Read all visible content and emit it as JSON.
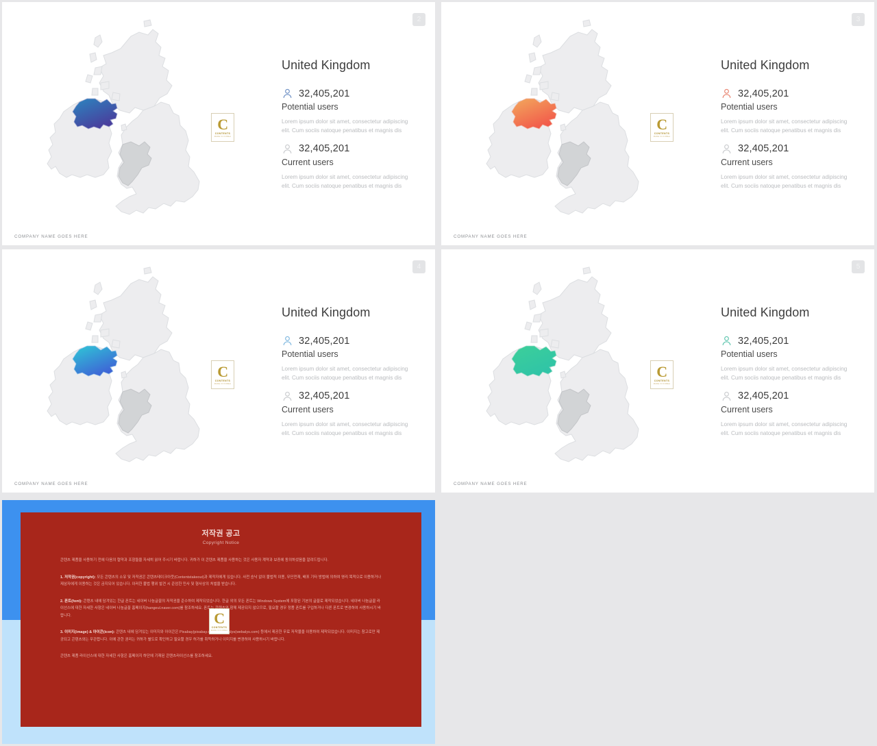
{
  "app": {
    "background": "#e7e7e9",
    "canvas_size": "1280x1089"
  },
  "brand": {
    "letter": "C",
    "name": "CONTENTS",
    "subtitle": "MADE  IN  KOREA"
  },
  "slides": [
    {
      "page": "2",
      "country": "United Kingdom",
      "accent": "#6d8fc4",
      "region_gradient_from": "#2b86c0",
      "region_gradient_to": "#4a3d9c",
      "highlight_region": "Northern Ireland",
      "secondary_region": "Wales",
      "potential": {
        "value": "32,405,201",
        "label": "Potential users",
        "desc": "Lorem ipsum dolor sit amet, consectetur adipiscing elit. Cum sociis natoque penatibus et magnis dis"
      },
      "current": {
        "value": "32,405,201",
        "label": "Current users",
        "desc": "Lorem ipsum dolor sit amet, consectetur adipiscing elit. Cum sociis natoque penatibus et magnis dis"
      },
      "footer": "COMPANY NAME GOES HERE"
    },
    {
      "page": "3",
      "country": "United Kingdom",
      "accent": "#e8836f",
      "region_gradient_from": "#f2a65c",
      "region_gradient_to": "#f2564a",
      "highlight_region": "Northern Ireland",
      "secondary_region": "Wales",
      "potential": {
        "value": "32,405,201",
        "label": "Potential users",
        "desc": "Lorem ipsum dolor sit amet, consectetur adipiscing elit. Cum sociis natoque penatibus et magnis dis"
      },
      "current": {
        "value": "32,405,201",
        "label": "Current users",
        "desc": "Lorem ipsum dolor sit amet, consectetur adipiscing elit. Cum sociis natoque penatibus et magnis dis"
      },
      "footer": "COMPANY NAME GOES HERE"
    },
    {
      "page": "4",
      "country": "United Kingdom",
      "accent": "#7fb8e0",
      "region_gradient_from": "#2fc4d6",
      "region_gradient_to": "#3f5fd6",
      "highlight_region": "Northern Ireland",
      "secondary_region": "Wales",
      "potential": {
        "value": "32,405,201",
        "label": "Potential users",
        "desc": "Lorem ipsum dolor sit amet, consectetur adipiscing elit. Cum sociis natoque penatibus et magnis dis"
      },
      "current": {
        "value": "32,405,201",
        "label": "Current users",
        "desc": "Lorem ipsum dolor sit amet, consectetur adipiscing elit. Cum sociis natoque penatibus et magnis dis"
      },
      "footer": "COMPANY NAME GOES HERE"
    },
    {
      "page": "5",
      "country": "United Kingdom",
      "accent": "#5ec5ae",
      "region_gradient_from": "#3ccf9a",
      "region_gradient_to": "#2fc3a8",
      "highlight_region": "Northern Ireland",
      "secondary_region": "Wales",
      "potential": {
        "value": "32,405,201",
        "label": "Potential users",
        "desc": "Lorem ipsum dolor sit amet, consectetur adipiscing elit. Cum sociis natoque penatibus et magnis dis"
      },
      "current": {
        "value": "32,405,201",
        "label": "Current users",
        "desc": "Lorem ipsum dolor sit amet, consectetur adipiscing elit. Cum sociis natoque penatibus et magnis dis"
      },
      "footer": "COMPANY NAME GOES HERE"
    }
  ],
  "copyright": {
    "title": "저작권 공고",
    "subtitle": "Copyright Notice",
    "intro": "콘텐츠 제품을 사용하기 전에 다음의 협약과 조항들을 자세히 읽어 주시기 바랍니다. 귀하가 이 콘텐츠 제품을 사용하는 것은 사용자 계약과 보증에 동의하셨음을 알려드립니다.",
    "item1_head": "1. 저작권(copyright):",
    "item1_body": "모든 콘텐츠의 소유 및 저작권은 콘텐츠테이크아웃(Contentstakeout)과 제작자에게 있습니다. 사전 승낙 없이 불법적 이용, 무단전재, 배포 기타 방법에 의하여 영리 목적으로 이용하거나 제삼자에게 이용하는 것은 금지되어 있습니다. 이러한 불법 행위 발견 시 준엄한 민사 및 형사상의 처벌을 받습니다.",
    "item2_head": "2. 폰트(font):",
    "item2_body": "콘텐츠 내에 담겨있는 한글 폰트는 네이버 나눔글꼴의 저작권을 준수하여 제작되었습니다. 한글 외의 모든 폰트는 Windows System에 포함된 기본의 글꼴로 제작되었습니다. 네이버 나눔글꼴 라이선스에 대한 자세한 사항은 네이버 나눔글꼴 홈페이지(hangeul.naver.com)를 참조하세요. 폰트는 콘텐츠와 함께 제공되지 않으므로, 필요할 경우 정품 폰트를 구입하거나 다른 폰트로 변경하여 사용하시기 바랍니다.",
    "item3_head": "3. 이미지(image) & 아이콘(icon):",
    "item3_body": "콘텐츠 내에 담겨있는 이미지와 아이콘은 Pixabay(pixabay.com)와 Webalys(webalys.com) 등에서 제공한 무료 저작물을 이용하여 제작되었습니다. 이미지는 참고로만 제공되고 콘텐츠와는 무관합니다. 이에 관한 권리는 귀하가 별도로 확인하고 필요할 경우 허가를 취득하거나 이미지를 변경하여 사용하시기 바랍니다.",
    "outro": "콘텐츠 제품 라이선스에 대한 자세한 사항은 홈페이지 하단에 기재된 콘텐츠라이선스를 참조하세요.",
    "box_color": "#a8261b",
    "slide_blue_front": "#3d91ef",
    "slide_blue_back": "#bfe2fb"
  }
}
